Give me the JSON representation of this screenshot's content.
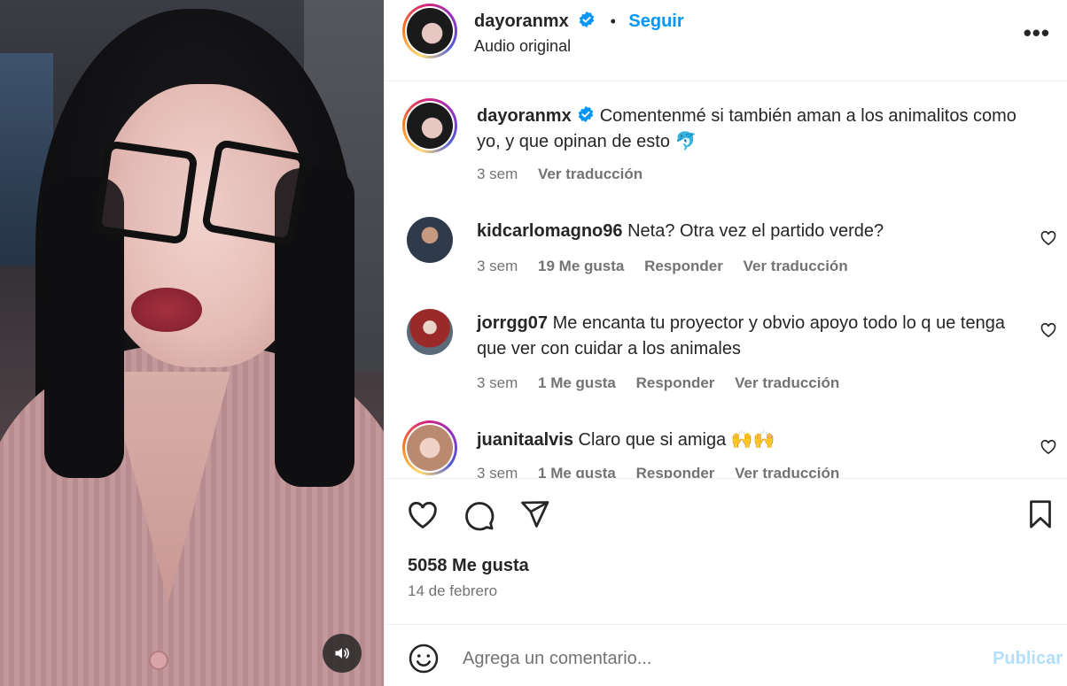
{
  "post": {
    "username": "dayoranmx",
    "follow_label": "Seguir",
    "subtitle": "Audio original",
    "more_label": "•••",
    "caption": {
      "username": "dayoranmx",
      "text": "Comentenmé si también aman a los animalitos como yo, y que opinan de esto 🐬",
      "time": "3 sem",
      "translate": "Ver traducción"
    }
  },
  "comments": [
    {
      "username": "kidcarlomagno96",
      "text": "Neta? Otra vez el partido verde?",
      "time": "3 sem",
      "likes": "19 Me gusta",
      "reply": "Responder",
      "translate": "Ver traducción"
    },
    {
      "username": "jorrgg07",
      "text": "Me encanta tu proyector y obvio apoyo todo lo q ue tenga que ver con cuidar a los animales",
      "time": "3 sem",
      "likes": "1 Me gusta",
      "reply": "Responder",
      "translate": "Ver traducción"
    },
    {
      "username": "juanitaalvis",
      "text": "Claro que si amiga 🙌🙌",
      "time": "3 sem",
      "likes": "1 Me gusta",
      "reply": "Responder",
      "translate": "Ver traducción"
    }
  ],
  "stats": {
    "likes": "5058 Me gusta",
    "date": "14 de febrero"
  },
  "composer": {
    "placeholder": "Agrega un comentario...",
    "post_label": "Publicar"
  },
  "colors": {
    "link": "#0095f6",
    "muted": "#737373",
    "post_disabled": "#b2dffc",
    "text": "#262626"
  },
  "icons": [
    "volume-icon",
    "verified-badge-icon",
    "more-options-icon",
    "heart-icon",
    "comment-icon",
    "share-icon",
    "bookmark-icon",
    "emoji-icon"
  ]
}
